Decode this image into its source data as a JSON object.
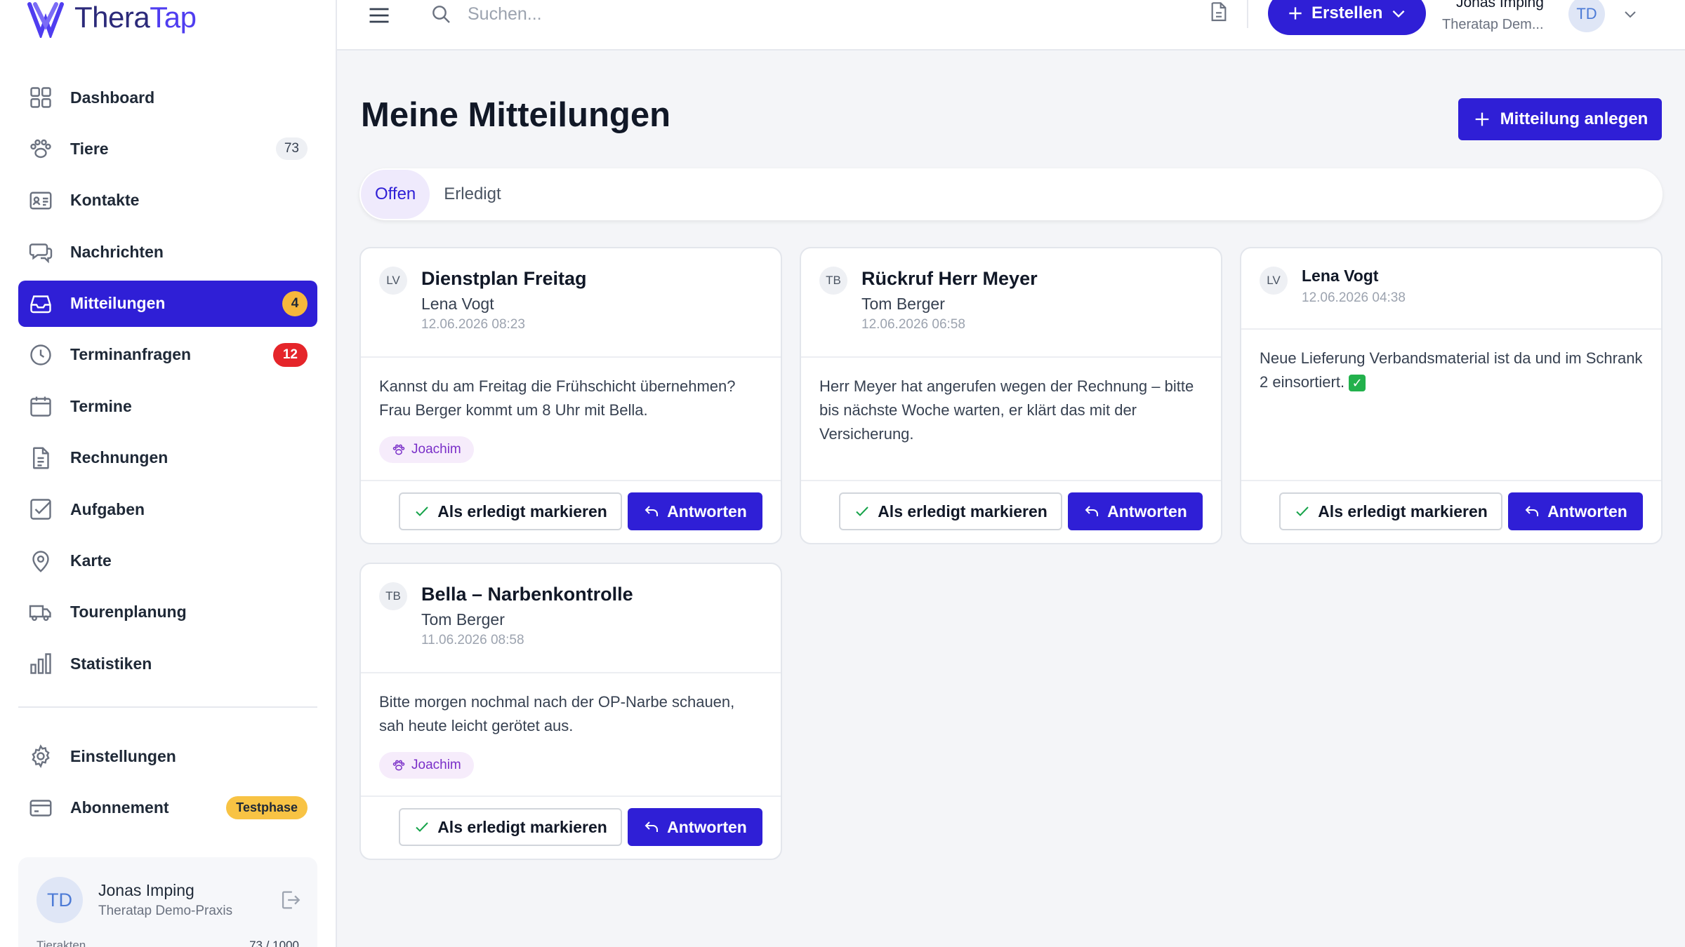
{
  "app": {
    "brand_thera": "Thera",
    "brand_tap": "Tap"
  },
  "sidebar": {
    "items": [
      {
        "label": "Dashboard",
        "icon": "grid-icon"
      },
      {
        "label": "Tiere",
        "icon": "paw-icon",
        "count": "73"
      },
      {
        "label": "Kontakte",
        "icon": "contact-card-icon"
      },
      {
        "label": "Nachrichten",
        "icon": "chat-icon"
      },
      {
        "label": "Mitteilungen",
        "icon": "inbox-icon",
        "count": "4",
        "active": true
      },
      {
        "label": "Terminanfragen",
        "icon": "clock-icon",
        "count": "12"
      },
      {
        "label": "Termine",
        "icon": "calendar-icon"
      },
      {
        "label": "Rechnungen",
        "icon": "document-icon"
      },
      {
        "label": "Aufgaben",
        "icon": "checkbox-icon"
      },
      {
        "label": "Karte",
        "icon": "map-pin-icon"
      },
      {
        "label": "Tourenplanung",
        "icon": "truck-icon"
      },
      {
        "label": "Statistiken",
        "icon": "bar-chart-icon"
      }
    ],
    "bottom_items": [
      {
        "label": "Einstellungen",
        "icon": "gear-icon"
      },
      {
        "label": "Abonnement",
        "icon": "credit-card-icon",
        "badge": "Testphase"
      }
    ],
    "user": {
      "initials": "TD",
      "name": "Jonas Imping",
      "org": "Theratap Demo-Praxis",
      "quota_label": "Tierakten",
      "quota_value": "73 / 1000"
    }
  },
  "topbar": {
    "search_placeholder": "Suchen...",
    "create_label": "Erstellen",
    "user_name": "Jonas Imping",
    "user_org": "Theratap Dem...",
    "user_initials": "TD"
  },
  "main": {
    "title": "Meine Mitteilungen",
    "new_button": "Mitteilung anlegen",
    "tabs": [
      {
        "label": "Offen",
        "active": true
      },
      {
        "label": "Erledigt",
        "active": false
      }
    ],
    "cards": [
      {
        "initials": "LV",
        "title": "Dienstplan Freitag",
        "author": "Lena Vogt",
        "date": "12.06.2026 08:23",
        "body": "Kannst du am Freitag die Frühschicht übernehmen? Frau Berger kommt um 8 Uhr mit Bella.",
        "tag": "Joachim"
      },
      {
        "initials": "TB",
        "title": "Rückruf Herr Meyer",
        "author": "Tom Berger",
        "date": "12.06.2026 06:58",
        "body": "Herr Meyer hat angerufen wegen der Rechnung – bitte bis nächste Woche warten, er klärt das mit der Versicherung."
      },
      {
        "initials": "LV",
        "author": "Lena Vogt",
        "date": "12.06.2026 04:38",
        "body": "Neue Lieferung Verbandsmaterial ist da und im Schrank 2 einsortiert.",
        "emoji": "✓"
      },
      {
        "initials": "TB",
        "title": "Bella – Narbenkontrolle",
        "author": "Tom Berger",
        "date": "11.06.2026 08:58",
        "body": "Bitte morgen nochmal nach der OP-Narbe schauen, sah heute leicht gerötet aus.",
        "tag": "Joachim"
      }
    ],
    "done_label": "Als erledigt markieren",
    "reply_label": "Antworten"
  },
  "colors": {
    "primary": "#2f1fd6",
    "count_yellow": "#f6b73c",
    "count_red": "#e5252a",
    "tag_bg": "#f6ecfb",
    "tag_text": "#7a2fc8"
  }
}
